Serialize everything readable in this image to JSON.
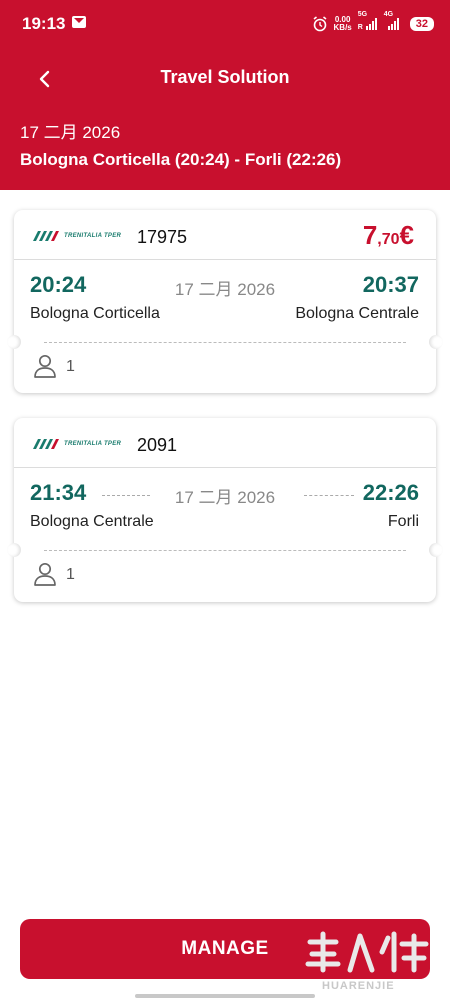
{
  "status_bar": {
    "time": "19:13",
    "net_speed_value": "0.00",
    "net_speed_unit": "KB/s",
    "signal1_label": "5G",
    "signal2_label": "4G",
    "signal_sub": "R",
    "battery": "32"
  },
  "header": {
    "title": "Travel Solution",
    "date": "17 二月 2026",
    "route": "Bologna Corticella (20:24) - Forli (22:26)"
  },
  "legs": [
    {
      "operator_logo": "TRENITALIA TPER",
      "train_number": "17975",
      "price_int": "7",
      "price_dec": ",70",
      "price_currency": "€",
      "dep_time": "20:24",
      "arr_time": "20:37",
      "date": "17 二月 2026",
      "dep_station": "Bologna Corticella",
      "arr_station": "Bologna Centrale",
      "passengers": "1"
    },
    {
      "operator_logo": "TRENITALIA TPER",
      "train_number": "2091",
      "dep_time": "21:34",
      "arr_time": "22:26",
      "date": "17 二月 2026",
      "dep_station": "Bologna Centrale",
      "arr_station": "Forli",
      "passengers": "1"
    }
  ],
  "footer": {
    "manage_label": "MANAGE",
    "watermark_text": "HUARENJIE"
  },
  "colors": {
    "brand": "#c8102e",
    "time_green": "#12675f"
  }
}
